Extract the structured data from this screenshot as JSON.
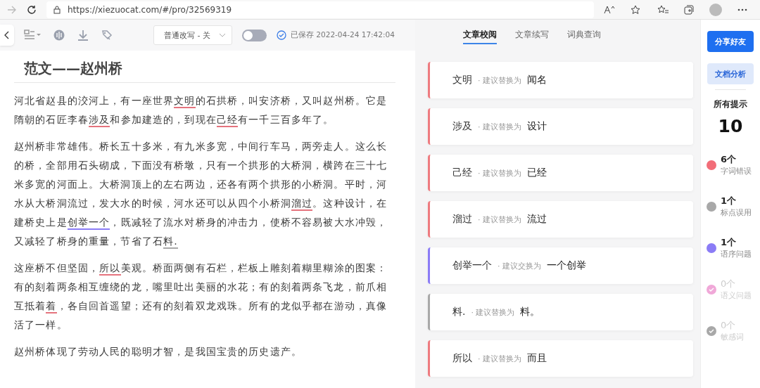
{
  "browser": {
    "url": "https://xiezuocat.com/#/pro/32569319"
  },
  "toolbar": {
    "mode_dropdown": "普通改写 - 关",
    "toggle_on": false,
    "save_status": "已保存 2022-04-24 17:42:04"
  },
  "tabs": [
    {
      "label": "文章校阅",
      "selected": true
    },
    {
      "label": "文章续写",
      "selected": false
    },
    {
      "label": "词典查询",
      "selected": false
    }
  ],
  "document": {
    "title": "范文——赵州桥",
    "paragraphs": [
      [
        {
          "text": "河北省赵县的洨河上，有一座世界"
        },
        {
          "text": "文明",
          "color": "#e5737d"
        },
        {
          "text": "的石拱桥，叫安济桥，又叫赵州桥。它是隋朝的石匠李春"
        },
        {
          "text": "涉及",
          "color": "#e5737d"
        },
        {
          "text": "和参加建造的，到现在"
        },
        {
          "text": "己经",
          "color": "#e5737d"
        },
        {
          "text": "有一千三百多年了。"
        }
      ],
      [
        {
          "text": "赵州桥非常雄伟。桥长五十多米，有九米多宽，中间行车马，两旁走人。这么长的桥，全部用石头砌成，下面没有桥墩，只有一个拱形的大桥洞，横跨在三十七米多宽的河面上。大桥洞顶上的左右两边，还各有两个拱形的小桥洞。平时，河水从大桥洞流过，发大水的时候，河水还可以从四个小桥洞"
        },
        {
          "text": "溜过",
          "color": "#e5737d"
        },
        {
          "text": "。这种设计，在建桥史上是"
        },
        {
          "text": "创举一个",
          "color": "#8b7cf6"
        },
        {
          "text": "，既减轻了流水对桥身的冲击力，使桥不容易被大水冲毁，又减轻了桥身的重量，节省了石"
        },
        {
          "text": "料.",
          "color": "#a8a8a8"
        }
      ],
      [
        {
          "text": "这座桥不但坚固，"
        },
        {
          "text": "所以",
          "color": "#e5737d"
        },
        {
          "text": "美观。桥面两侧有石栏，栏板上雕刻着糊里糊涂的图案：有的刻着两条相互缠绕的龙，嘴里吐出美丽的水花；有的刻着两条飞龙，前爪相互抵着"
        },
        {
          "text": "着",
          "color": "#e5737d"
        },
        {
          "text": "，各自回首遥望；还有的刻着双龙戏珠。所有的龙似乎都在游动，真像活了一样。"
        }
      ],
      [
        {
          "text": "赵州桥体现了劳动人民的聪明才智，是我国宝贵的历史遗产。"
        }
      ]
    ]
  },
  "suggestions": [
    {
      "word": "文明",
      "hint": "· 建议替换为",
      "replacement": "闻名",
      "color": "#ee7b80"
    },
    {
      "word": "涉及",
      "hint": "· 建议替换为",
      "replacement": "设计",
      "color": "#ee7b80"
    },
    {
      "word": "己经",
      "hint": "· 建议替换为",
      "replacement": "已经",
      "color": "#ee7b80"
    },
    {
      "word": "溜过",
      "hint": "· 建议替换为",
      "replacement": "流过",
      "color": "#ee7b80"
    },
    {
      "word": "创举一个",
      "hint": "· 建议交换为",
      "replacement": "一个创举",
      "color": "#8b7cf6"
    },
    {
      "word": "料.",
      "hint": "· 建议替换为",
      "replacement": "料。",
      "color": "#a8a8a8"
    },
    {
      "word": "所以",
      "hint": "· 建议替换为",
      "replacement": "而且",
      "color": "#ee7b80"
    }
  ],
  "sidebar": {
    "share_button": "分享好友",
    "analysis_button": "文档分析",
    "total_label": "所有提示",
    "total": "10",
    "stats": [
      {
        "count": "6个",
        "label": "字词错误",
        "color": "#f26d78",
        "done": false
      },
      {
        "count": "1个",
        "label": "标点误用",
        "color": "#a8a8a8",
        "done": false
      },
      {
        "count": "1个",
        "label": "语序问题",
        "color": "#8b7cf6",
        "done": false
      },
      {
        "count": "0个",
        "label": "语义问题",
        "color": "#f0a8d8",
        "done": true
      },
      {
        "count": "0个",
        "label": "敏感词",
        "color": "#a8a8a8",
        "done": true
      }
    ]
  }
}
